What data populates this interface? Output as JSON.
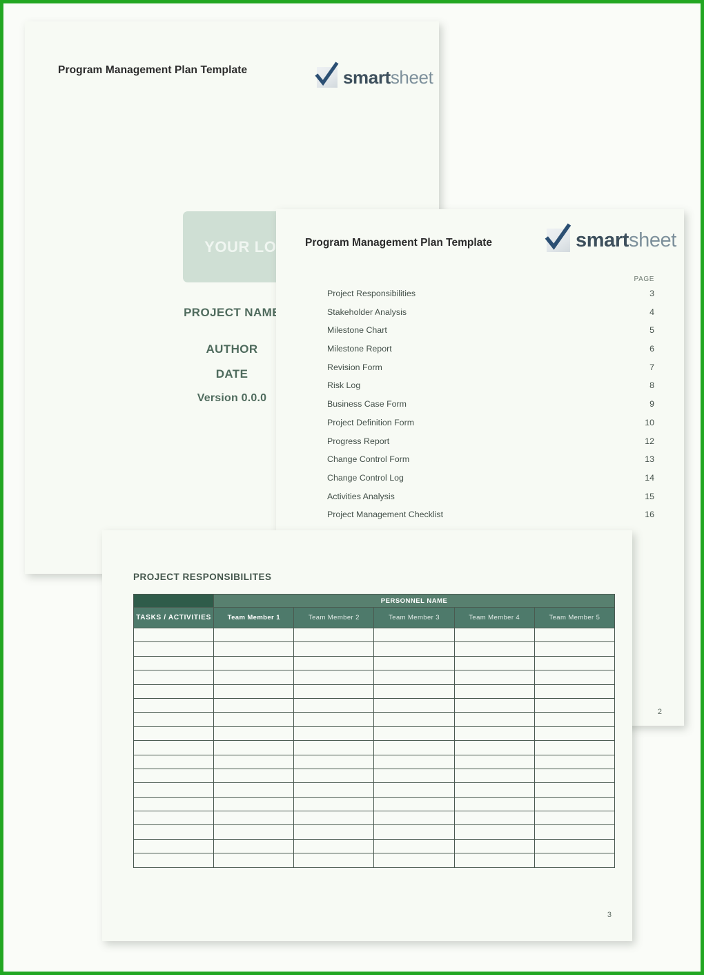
{
  "brand": {
    "name_bold": "smart",
    "name_light": "sheet",
    "accent_green": "#22a722",
    "table_header_dark": "#2f5c4a",
    "table_header_mid": "#4e7a6b",
    "logo_box_fill": "#cfdfd4"
  },
  "cover": {
    "title": "Program Management Plan Template",
    "logo_placeholder": "YOUR LOGO",
    "project_name": "PROJECT NAME",
    "author": "AUTHOR",
    "date": "DATE",
    "version": "Version 0.0.0"
  },
  "toc": {
    "title": "Program Management Plan Template",
    "page_column_header": "PAGE",
    "page_number": "2",
    "entries": [
      {
        "label": "Project Responsibilities",
        "page": "3"
      },
      {
        "label": "Stakeholder Analysis",
        "page": "4"
      },
      {
        "label": "Milestone Chart",
        "page": "5"
      },
      {
        "label": "Milestone Report",
        "page": "6"
      },
      {
        "label": "Revision Form",
        "page": "7"
      },
      {
        "label": "Risk Log",
        "page": "8"
      },
      {
        "label": "Business Case Form",
        "page": "9"
      },
      {
        "label": "Project Definition Form",
        "page": "10"
      },
      {
        "label": "Progress Report",
        "page": "12"
      },
      {
        "label": "Change Control Form",
        "page": "13"
      },
      {
        "label": "Change Control Log",
        "page": "14"
      },
      {
        "label": "Activities Analysis",
        "page": "15"
      },
      {
        "label": "Project Management Checklist",
        "page": "16"
      }
    ]
  },
  "responsibilities": {
    "heading": "PROJECT RESPONSIBILITES",
    "group_header": "PERSONNEL NAME",
    "columns": [
      "TASKS / ACTIVITIES",
      "Team Member 1",
      "Team Member 2",
      "Team Member 3",
      "Team Member 4",
      "Team Member 5"
    ],
    "row_count": 17,
    "rows": [],
    "page_number": "3"
  }
}
